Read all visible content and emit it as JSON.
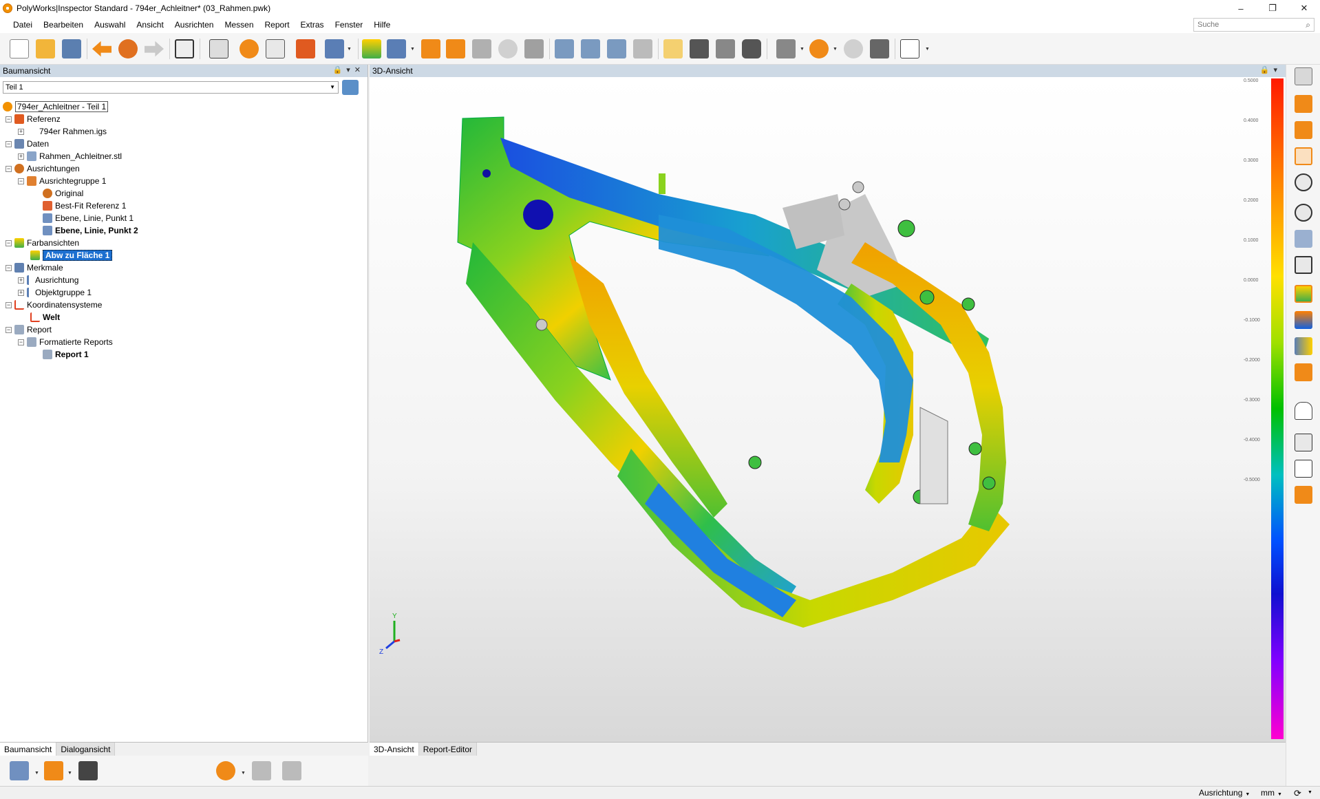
{
  "window": {
    "title": "PolyWorks|Inspector Standard - 794er_Achleitner* (03_Rahmen.pwk)",
    "minimize": "–",
    "maximize": "❐",
    "close": "✕"
  },
  "menu": [
    "Datei",
    "Bearbeiten",
    "Auswahl",
    "Ansicht",
    "Ausrichten",
    "Messen",
    "Report",
    "Extras",
    "Fenster",
    "Hilfe"
  ],
  "search": {
    "placeholder": "Suche"
  },
  "tree_panel": {
    "title": "Baumansicht",
    "part_selector": "Teil 1",
    "items": [
      {
        "label": "794er_Achleitner - Teil 1",
        "icon": "project-icon"
      },
      {
        "label": "Referenz",
        "icon": "reference-icon"
      },
      {
        "label": "794er Rahmen.igs",
        "icon": "cad-file-icon"
      },
      {
        "label": "Daten",
        "icon": "data-icon"
      },
      {
        "label": "Rahmen_Achleitner.stl",
        "icon": "mesh-icon"
      },
      {
        "label": "Ausrichtungen",
        "icon": "alignments-icon"
      },
      {
        "label": "Ausrichtegruppe 1",
        "icon": "alignment-group-icon"
      },
      {
        "label": "Original",
        "icon": "alignment-icon"
      },
      {
        "label": "Best-Fit Referenz 1",
        "icon": "best-fit-icon"
      },
      {
        "label": "Ebene, Linie, Punkt 1",
        "icon": "plane-line-point-icon"
      },
      {
        "label": "Ebene, Linie, Punkt 2",
        "icon": "plane-line-point-icon"
      },
      {
        "label": "Farbansichten",
        "icon": "color-maps-icon"
      },
      {
        "label": "Abw zu Fläche 1",
        "icon": "color-map-icon"
      },
      {
        "label": "Merkmale",
        "icon": "features-icon"
      },
      {
        "label": "Ausrichtung",
        "icon": "feature-icon"
      },
      {
        "label": "Objektgruppe 1",
        "icon": "object-group-icon"
      },
      {
        "label": "Koordinatensysteme",
        "icon": "coordinate-systems-icon"
      },
      {
        "label": "Welt",
        "icon": "coordinate-system-icon"
      },
      {
        "label": "Report",
        "icon": "report-icon"
      },
      {
        "label": "Formatierte Reports",
        "icon": "formatted-reports-icon"
      },
      {
        "label": "Report 1",
        "icon": "report-doc-icon"
      }
    ],
    "tabs": [
      "Baumansicht",
      "Dialogansicht"
    ]
  },
  "view3d": {
    "title": "3D-Ansicht",
    "tabs": [
      "3D-Ansicht",
      "Report-Editor"
    ],
    "axes": {
      "y": "Y",
      "z": "Z"
    },
    "colorbar_labels": [
      "0.5000",
      "0.4000",
      "0.3000",
      "0.2000",
      "0.1000",
      "0.0000",
      "-0.1000",
      "-0.2000",
      "-0.3000",
      "-0.4000",
      "-0.5000"
    ]
  },
  "status": {
    "alignment": "Ausrichtung",
    "unit": "mm"
  },
  "colors": {
    "panel_header": "#cdd9e5",
    "selection": "#1c6fd0",
    "accent_orange": "#f29100"
  }
}
